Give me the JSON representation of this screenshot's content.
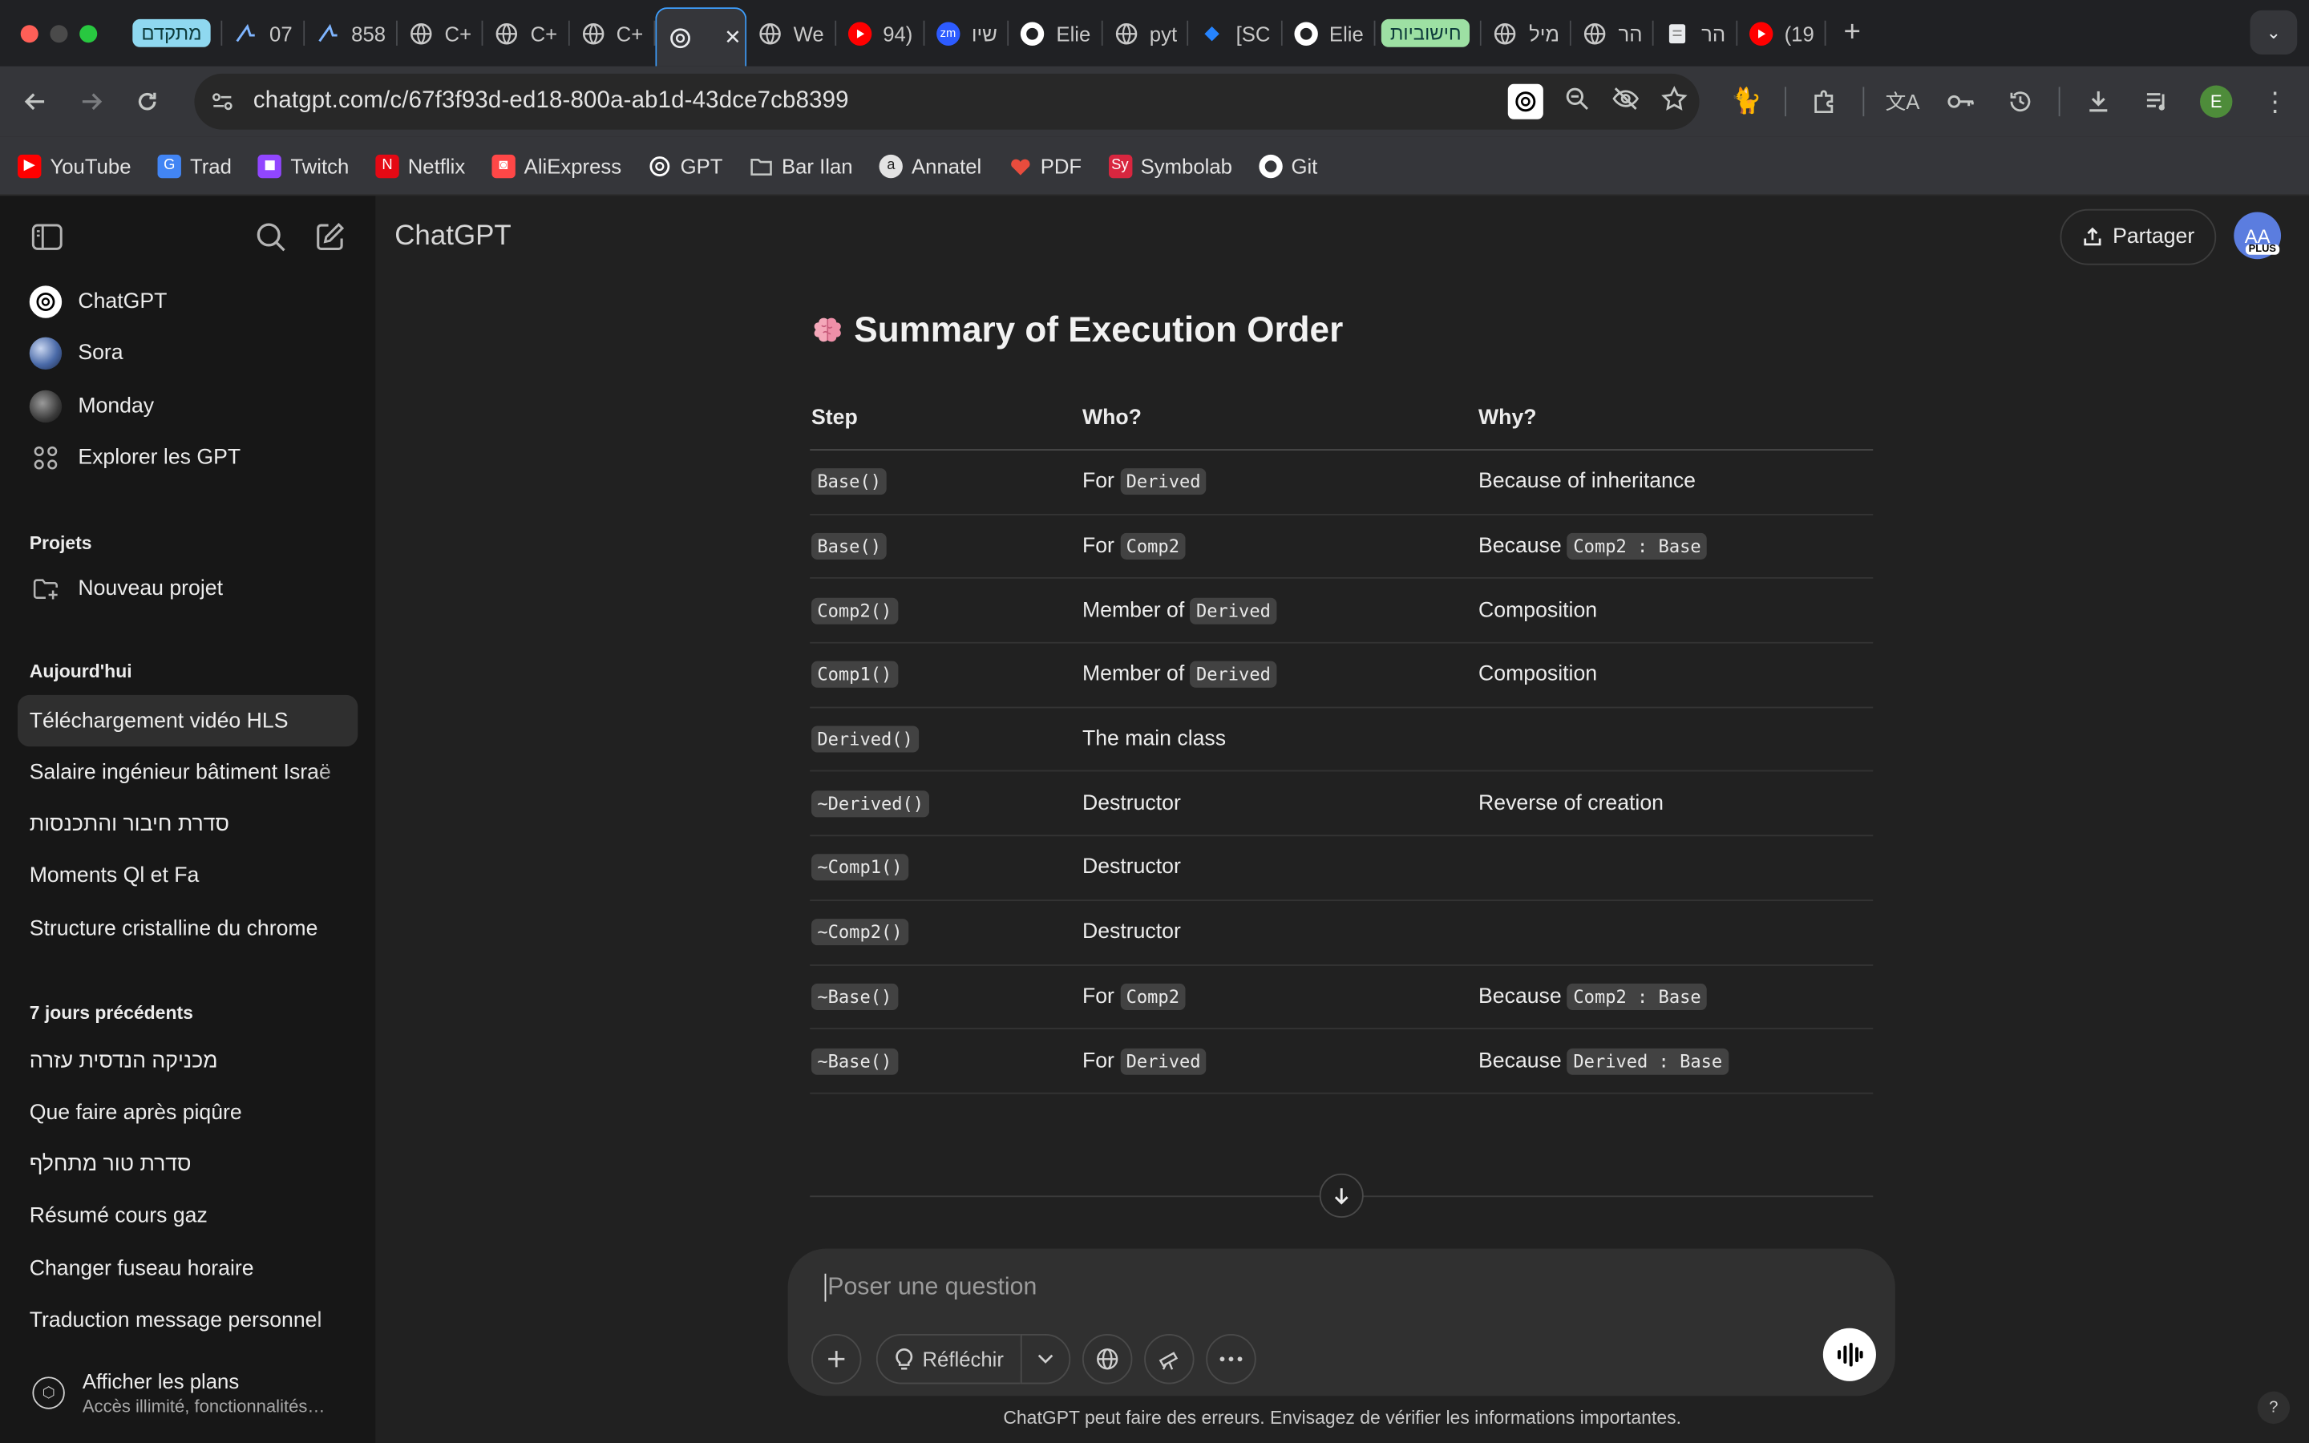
{
  "browser": {
    "tabs": [
      {
        "label": "מתקדם",
        "kind": "tag",
        "color": "#8fd8f0"
      },
      {
        "label": "07",
        "icon": "arrow-favicon"
      },
      {
        "label": "858",
        "icon": "arrow-favicon"
      },
      {
        "label": "C+",
        "icon": "globe-icon"
      },
      {
        "label": "C+",
        "icon": "globe-icon"
      },
      {
        "label": "C+",
        "icon": "globe-icon"
      },
      {
        "label": "",
        "icon": "chatgpt-icon",
        "active": true
      },
      {
        "label": "We",
        "icon": "globe-icon"
      },
      {
        "label": "94)",
        "icon": "youtube-icon"
      },
      {
        "label": "שיו",
        "icon": "zoom-icon"
      },
      {
        "label": "Elie",
        "icon": "github-icon"
      },
      {
        "label": "pyt",
        "icon": "globe-icon"
      },
      {
        "label": "[SC",
        "icon": "jira-icon"
      },
      {
        "label": "Elie",
        "icon": "github-icon"
      },
      {
        "label": "חישוביות",
        "kind": "tag",
        "color": "#9de0a3"
      },
      {
        "label": "מיל",
        "icon": "globe-icon"
      },
      {
        "label": "הר",
        "icon": "globe-icon"
      },
      {
        "label": "הר",
        "icon": "doc-icon"
      },
      {
        "label": "(19",
        "icon": "youtube-icon"
      }
    ],
    "url": "chatgpt.com/c/67f3f93d-ed18-800a-ab1d-43dce7cb8399",
    "profile_initial": "E",
    "bookmarks": [
      {
        "label": "YouTube",
        "icon": "youtube-icon",
        "color": "#ff0000"
      },
      {
        "label": "Trad",
        "icon": "translate-icon",
        "color": "#4285f4"
      },
      {
        "label": "Twitch",
        "icon": "twitch-icon",
        "color": "#9146ff"
      },
      {
        "label": "Netflix",
        "icon": "netflix-icon",
        "color": "#e50914"
      },
      {
        "label": "AliExpress",
        "icon": "aliexpress-icon",
        "color": "#ff4747"
      },
      {
        "label": "GPT",
        "icon": "chatgpt-icon",
        "color": "#ffffff"
      },
      {
        "label": "Bar Ilan",
        "icon": "folder-icon",
        "color": "#c4c7c5"
      },
      {
        "label": "Annatel",
        "icon": "annatel-icon",
        "color": "#222222"
      },
      {
        "label": "PDF",
        "icon": "pdf-heart-icon",
        "color": "#e84c3d"
      },
      {
        "label": "Symbolab",
        "icon": "symbolab-icon",
        "color": "#d8263f"
      },
      {
        "label": "Git",
        "icon": "github-icon",
        "color": "#ffffff"
      }
    ]
  },
  "sidebar": {
    "apps": [
      {
        "label": "ChatGPT",
        "icon": "chatgpt-icon"
      },
      {
        "label": "Sora",
        "icon": "sora-avatar"
      },
      {
        "label": "Monday",
        "icon": "monday-avatar"
      },
      {
        "label": "Explorer les GPT",
        "icon": "grid-icon"
      }
    ],
    "projects_heading": "Projets",
    "new_project": "Nouveau projet",
    "today_heading": "Aujourd'hui",
    "today": [
      "Téléchargement vidéo HLS",
      "Salaire ingénieur bâtiment Israë",
      "סדרת חיבור והתכנסות",
      "Moments Ql et Fa",
      "Structure cristalline du chrome"
    ],
    "week_heading": "7 jours précédents",
    "week": [
      "מכניקה הנדסית עזרה",
      "Que faire après piqûre",
      "סדרת טור מתחלף",
      "Résumé cours gaz",
      "Changer fuseau horaire",
      "Traduction message personnel"
    ],
    "plans_title": "Afficher les plans",
    "plans_subtitle": "Accès illimité, fonctionnalités…"
  },
  "header": {
    "title": "ChatGPT",
    "share_label": "Partager",
    "avatar_initials": "AA",
    "plan_badge": "PLUS"
  },
  "message": {
    "heading": "Summary of Execution Order",
    "columns": [
      "Step",
      "Who?",
      "Why?"
    ],
    "rows": [
      {
        "step": "Base()",
        "who_prefix": "For",
        "who_code": "Derived",
        "why_prefix": "Because of inheritance",
        "why_code": ""
      },
      {
        "step": "Base()",
        "who_prefix": "For",
        "who_code": "Comp2",
        "why_prefix": "Because",
        "why_code": "Comp2 : Base"
      },
      {
        "step": "Comp2()",
        "who_prefix": "Member of",
        "who_code": "Derived",
        "why_prefix": "Composition",
        "why_code": ""
      },
      {
        "step": "Comp1()",
        "who_prefix": "Member of",
        "who_code": "Derived",
        "why_prefix": "Composition",
        "why_code": ""
      },
      {
        "step": "Derived()",
        "who_prefix": "The main class",
        "who_code": "",
        "why_prefix": "",
        "why_code": ""
      },
      {
        "step": "~Derived()",
        "who_prefix": "Destructor",
        "who_code": "",
        "why_prefix": "Reverse of creation",
        "why_code": ""
      },
      {
        "step": "~Comp1()",
        "who_prefix": "Destructor",
        "who_code": "",
        "why_prefix": "",
        "why_code": ""
      },
      {
        "step": "~Comp2()",
        "who_prefix": "Destructor",
        "who_code": "",
        "why_prefix": "",
        "why_code": ""
      },
      {
        "step": "~Base()",
        "who_prefix": "For",
        "who_code": "Comp2",
        "why_prefix": "Because",
        "why_code": "Comp2 : Base"
      },
      {
        "step": "~Base()",
        "who_prefix": "For",
        "who_code": "Derived",
        "why_prefix": "Because",
        "why_code": "Derived : Base"
      }
    ]
  },
  "composer": {
    "placeholder": "Poser une question",
    "think_label": "Réfléchir"
  },
  "footer": {
    "disclaimer": "ChatGPT peut faire des erreurs. Envisagez de vérifier les informations importantes.",
    "help": "?"
  }
}
